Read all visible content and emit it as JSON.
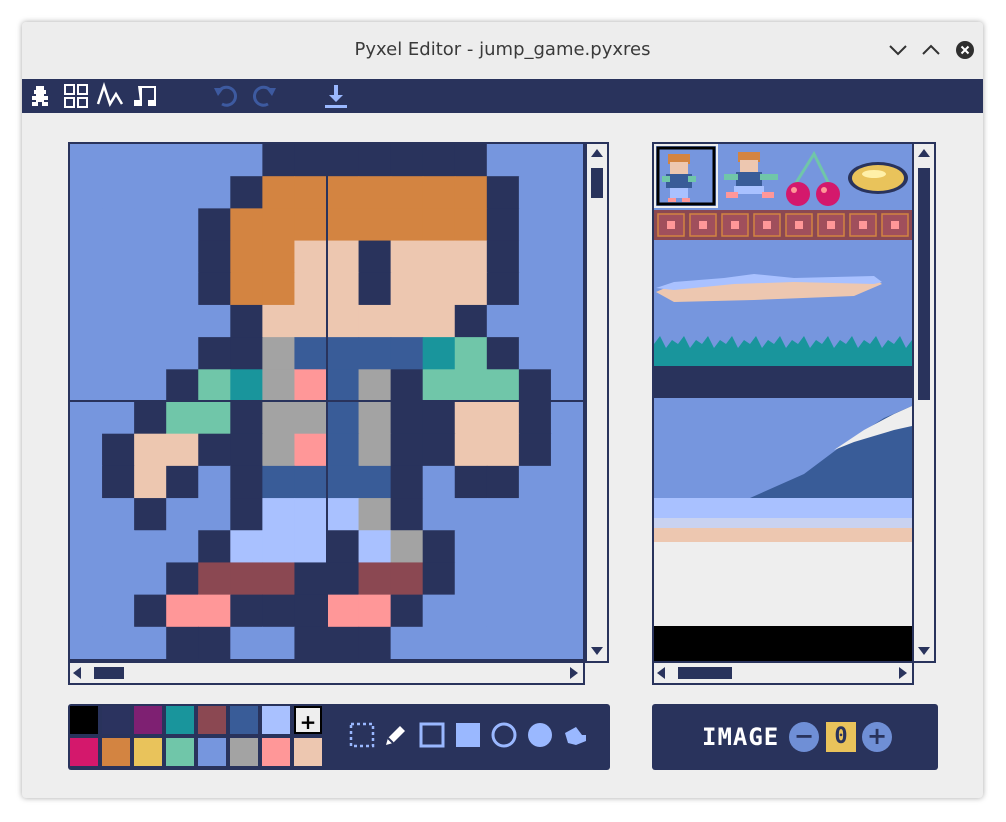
{
  "window": {
    "title": "Pyxel Editor - jump_game.pyxres"
  },
  "toolbar": {
    "editors": [
      "image-editor",
      "tilemap-editor",
      "sound-editor",
      "music-editor"
    ],
    "actions": [
      "undo",
      "redo",
      "save"
    ]
  },
  "palette": {
    "colors": [
      "#000000",
      "#2b335f",
      "#7e2072",
      "#19959c",
      "#8b4852",
      "#395c98",
      "#a9c1ff",
      "#eeeeee",
      "#d4186c",
      "#d38441",
      "#e9c35b",
      "#70c6a9",
      "#7696de",
      "#a3a3a3",
      "#ff9798",
      "#edc7b0"
    ],
    "add_label": "+"
  },
  "tools": [
    "select-tool",
    "pencil-tool",
    "rect-outline-tool",
    "rect-fill-tool",
    "circle-outline-tool",
    "circle-fill-tool",
    "bucket-tool"
  ],
  "image_bank": {
    "label": "IMAGE",
    "value": "0",
    "minus": "−",
    "plus": "+"
  },
  "colors": {
    "navy": "#29335c",
    "sky": "#7696de",
    "window_bg": "#eeeeee"
  }
}
